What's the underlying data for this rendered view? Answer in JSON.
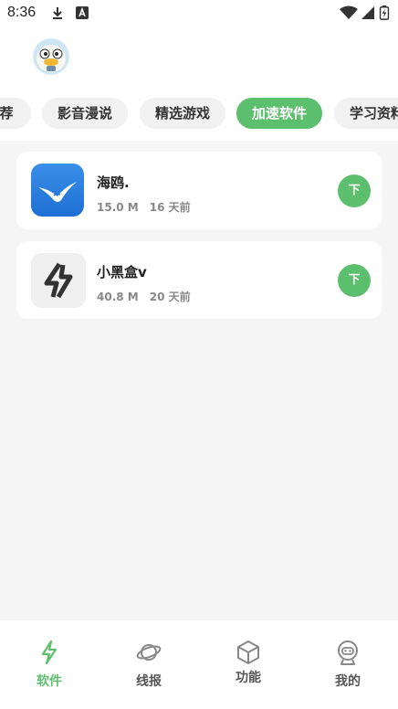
{
  "status_bar": {
    "time": "8:36",
    "icons": [
      "download-icon",
      "keyboard-a-icon",
      "wifi-icon",
      "signal-icon",
      "battery-charging-icon"
    ]
  },
  "header": {
    "avatar": "duck-avatar"
  },
  "tabs": [
    {
      "label": "荐",
      "active": false
    },
    {
      "label": "影音漫说",
      "active": false
    },
    {
      "label": "精选游戏",
      "active": false
    },
    {
      "label": "加速软件",
      "active": true
    },
    {
      "label": "学习资料",
      "active": false
    }
  ],
  "apps": [
    {
      "name": "海鸥.",
      "size": "15.0 M",
      "updated": "16 天前",
      "icon": "seagull-icon",
      "button_label": "下"
    },
    {
      "name": "小黑盒v",
      "size": "40.8 M",
      "updated": "20 天前",
      "icon": "lightning-box-icon",
      "button_label": "下"
    }
  ],
  "bottom_nav": [
    {
      "label": "软件",
      "icon": "lightning-icon",
      "active": true
    },
    {
      "label": "线报",
      "icon": "planet-icon",
      "active": false
    },
    {
      "label": "功能",
      "icon": "cube-icon",
      "active": false
    },
    {
      "label": "我的",
      "icon": "robot-face-icon",
      "active": false
    }
  ],
  "colors": {
    "accent": "#5cbf6d",
    "background": "#f5f5f5",
    "card": "#ffffff"
  }
}
